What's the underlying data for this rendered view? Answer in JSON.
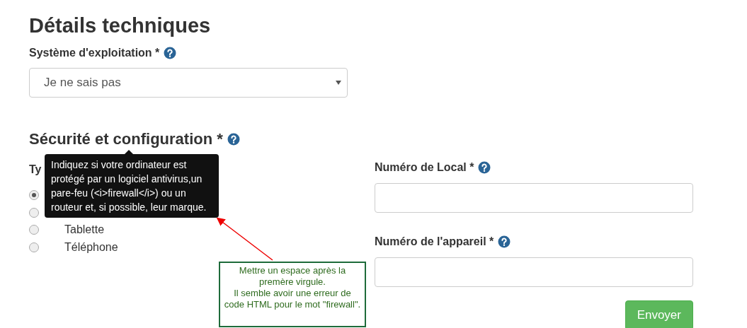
{
  "heading": "Détails techniques",
  "os_field": {
    "label": "Système d'exploitation *",
    "value": "Je ne sais pas"
  },
  "section": {
    "title": "Sécurité et configuration *"
  },
  "device_type": {
    "label": "Ty",
    "options": [
      {
        "selected": true
      },
      {
        "selected": false
      },
      {
        "label": "Tablette",
        "selected": false
      },
      {
        "label": "Téléphone",
        "selected": false
      }
    ]
  },
  "fields": [
    {
      "label": "Numéro de Local *"
    },
    {
      "label": "Numéro de l'appareil *"
    }
  ],
  "submit": "Envoyer",
  "tooltip": "Indiquez si votre ordinateur est protégé par un logiciel antivirus,un pare-feu (<i>firewall</i>) ou un routeur et, si possible, leur marque.",
  "annotation": [
    "Mettre un espace après la premère virgule.",
    "Il semble avoir une erreur de code HTML pour le mot \"firewall\"."
  ]
}
